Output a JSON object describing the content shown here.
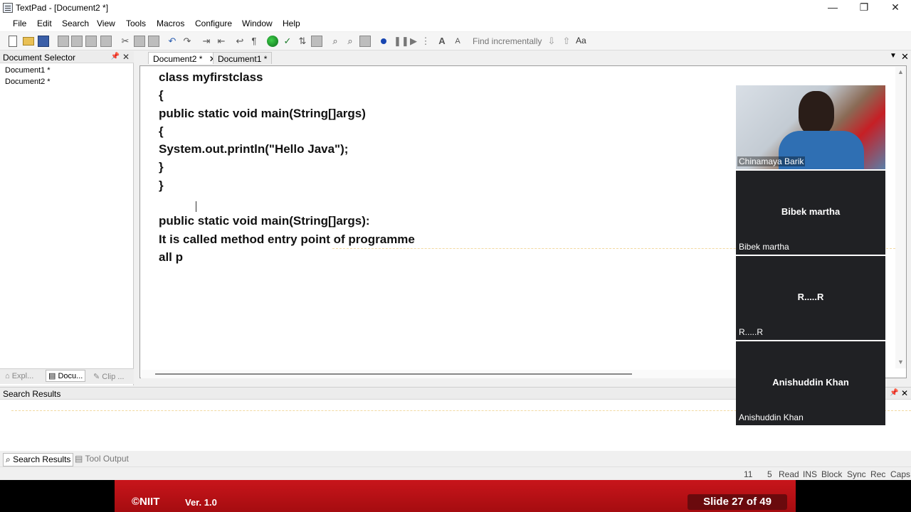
{
  "window": {
    "title": "TextPad - [Document2 *]"
  },
  "menu": [
    "File",
    "Edit",
    "Search",
    "View",
    "Tools",
    "Macros",
    "Configure",
    "Window",
    "Help"
  ],
  "toolbar": {
    "find_placeholder": "Find incrementally",
    "case_label": "Aa"
  },
  "doc_selector": {
    "title": "Document Selector",
    "items": [
      "Document1 *",
      "Document2 *"
    ],
    "tabs": [
      "Expl...",
      "Docu...",
      "Clip ..."
    ]
  },
  "editor": {
    "tabs": [
      "Document2 *",
      "Document1 *"
    ],
    "lines": [
      "class myfirstclass",
      "{",
      "public static void main(String[]args)",
      "{",
      "System.out.println(\"Hello Java\");",
      "}",
      "}",
      "",
      "public static void main(String[]args):",
      "It is called method entry point of programme",
      "all p"
    ]
  },
  "search_results": {
    "title": "Search Results",
    "tabs": [
      "Search Results",
      "Tool Output"
    ]
  },
  "status": {
    "line": "11",
    "col": "5",
    "flags": [
      "Read",
      "INS",
      "Block",
      "Sync",
      "Rec",
      "Caps"
    ]
  },
  "participants": [
    {
      "name": "Chinamaya Barik",
      "video": true
    },
    {
      "name": "Bibek martha",
      "video": false
    },
    {
      "name": "R.....R",
      "video": false
    },
    {
      "name": "Anishuddin Khan",
      "video": false
    }
  ],
  "footer": {
    "logo": "©NIIT",
    "version": "Ver. 1.0",
    "slide": "Slide 27 of 49"
  }
}
